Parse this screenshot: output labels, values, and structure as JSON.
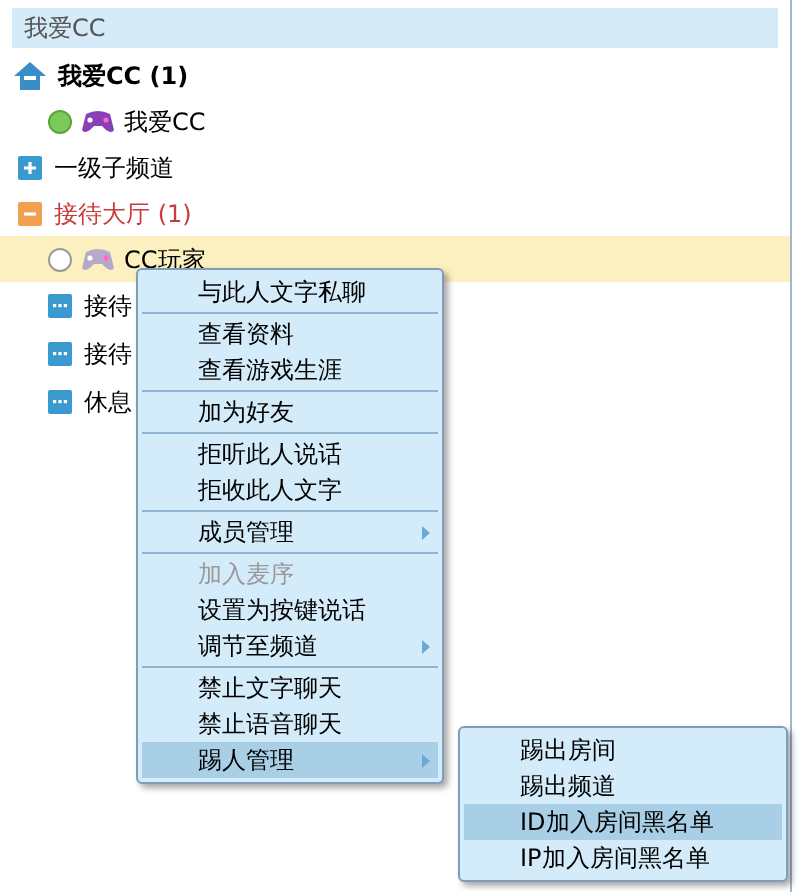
{
  "header": {
    "title": "我爱CC"
  },
  "tree": [
    {
      "kind": "room",
      "label": "我爱CC (1)",
      "children": [
        {
          "kind": "user",
          "label": "我爱CC",
          "online": true,
          "selected": false
        },
        {
          "kind": "channel",
          "label": "一级子频道",
          "expanded": false
        },
        {
          "kind": "channel",
          "label": "接待大厅 (1)",
          "expanded": true,
          "children": [
            {
              "kind": "user",
              "label": "CC玩家",
              "online": false,
              "selected": true
            },
            {
              "kind": "sub",
              "label": "接待"
            },
            {
              "kind": "sub",
              "label": "接待"
            },
            {
              "kind": "sub",
              "label": "休息"
            }
          ]
        }
      ]
    }
  ],
  "menu": [
    [
      {
        "label": "与此人文字私聊",
        "disabled": false,
        "submenu": false,
        "selected": false
      }
    ],
    [
      {
        "label": "查看资料",
        "disabled": false,
        "submenu": false,
        "selected": false
      },
      {
        "label": "查看游戏生涯",
        "disabled": false,
        "submenu": false,
        "selected": false
      }
    ],
    [
      {
        "label": "加为好友",
        "disabled": false,
        "submenu": false,
        "selected": false
      }
    ],
    [
      {
        "label": "拒听此人说话",
        "disabled": false,
        "submenu": false,
        "selected": false
      },
      {
        "label": "拒收此人文字",
        "disabled": false,
        "submenu": false,
        "selected": false
      }
    ],
    [
      {
        "label": "成员管理",
        "disabled": false,
        "submenu": true,
        "selected": false
      }
    ],
    [
      {
        "label": "加入麦序",
        "disabled": true,
        "submenu": false,
        "selected": false
      },
      {
        "label": "设置为按键说话",
        "disabled": false,
        "submenu": false,
        "selected": false
      },
      {
        "label": "调节至频道",
        "disabled": false,
        "submenu": true,
        "selected": false
      }
    ],
    [
      {
        "label": "禁止文字聊天",
        "disabled": false,
        "submenu": false,
        "selected": false
      },
      {
        "label": "禁止语音聊天",
        "disabled": false,
        "submenu": false,
        "selected": false
      },
      {
        "label": "踢人管理",
        "disabled": false,
        "submenu": true,
        "selected": true
      }
    ]
  ],
  "submenu": [
    {
      "label": "踢出房间",
      "selected": false
    },
    {
      "label": "踢出频道",
      "selected": false
    },
    {
      "label": "ID加入房间黑名单",
      "selected": true
    },
    {
      "label": "IP加入房间黑名单",
      "selected": false
    }
  ]
}
